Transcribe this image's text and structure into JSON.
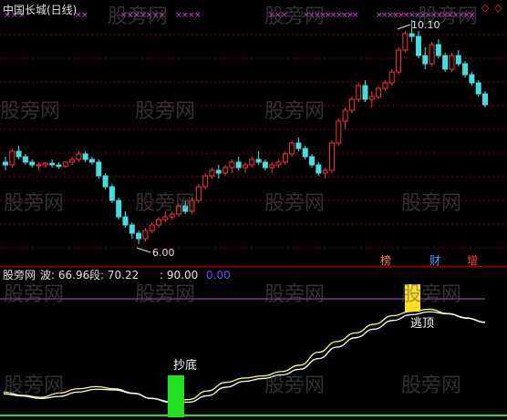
{
  "main_panel": {
    "title": "中国长城(日线)",
    "price_high_label": "10.10",
    "price_low_label": "6.00",
    "badges": [
      {
        "text": "榜",
        "color": "#ff8040"
      },
      {
        "text": "财",
        "color": "#40a0ff"
      },
      {
        "text": "增",
        "color": "#ff4040"
      }
    ],
    "diamond_color": "#ff3030"
  },
  "indicator_panel": {
    "name": "股旁网",
    "wave_label": "波: 66.96",
    "segment_label": "段: 70.22",
    "level_label": ": 90.00",
    "zero_label": "0.00",
    "bottom_signal": "抄底",
    "top_signal": "逃顶"
  },
  "watermark": "股旁网",
  "colors": {
    "up": "#ff3030",
    "down": "#40e0e0",
    "grid": "#8b0000",
    "ma_line": "#ffff60",
    "signal_white": "#ffffff",
    "level_line": "#c040c0",
    "bottom_bar": "#20e020",
    "top_bar": "#ffe020",
    "marker": "#e040e0"
  },
  "chart_data": {
    "type": "candlestick",
    "title": "中国长城(日线)",
    "annotations": [
      "10.10",
      "6.00"
    ],
    "approx_price_range": [
      6.0,
      10.1
    ],
    "candles": [
      [
        7.5,
        7.6,
        7.35,
        7.45
      ],
      [
        7.45,
        7.75,
        7.4,
        7.7
      ],
      [
        7.7,
        7.8,
        7.55,
        7.6
      ],
      [
        7.6,
        7.65,
        7.45,
        7.5
      ],
      [
        7.5,
        7.55,
        7.4,
        7.45
      ],
      [
        7.45,
        7.5,
        7.35,
        7.45
      ],
      [
        7.45,
        7.5,
        7.4,
        7.48
      ],
      [
        7.48,
        7.55,
        7.4,
        7.45
      ],
      [
        7.45,
        7.5,
        7.38,
        7.42
      ],
      [
        7.42,
        7.52,
        7.4,
        7.5
      ],
      [
        7.5,
        7.6,
        7.45,
        7.55
      ],
      [
        7.55,
        7.7,
        7.5,
        7.65
      ],
      [
        7.65,
        7.7,
        7.5,
        7.55
      ],
      [
        7.55,
        7.6,
        7.45,
        7.5
      ],
      [
        7.5,
        7.55,
        7.2,
        7.25
      ],
      [
        7.25,
        7.3,
        7.0,
        7.05
      ],
      [
        7.05,
        7.1,
        6.75,
        6.8
      ],
      [
        6.8,
        6.85,
        6.45,
        6.5
      ],
      [
        6.5,
        6.6,
        6.3,
        6.35
      ],
      [
        6.35,
        6.4,
        6.1,
        6.2
      ],
      [
        6.2,
        6.25,
        6.0,
        6.1
      ],
      [
        6.1,
        6.3,
        6.05,
        6.25
      ],
      [
        6.25,
        6.4,
        6.2,
        6.35
      ],
      [
        6.35,
        6.5,
        6.3,
        6.45
      ],
      [
        6.45,
        6.6,
        6.4,
        6.5
      ],
      [
        6.5,
        6.6,
        6.45,
        6.55
      ],
      [
        6.55,
        6.75,
        6.5,
        6.7
      ],
      [
        6.7,
        6.8,
        6.55,
        6.6
      ],
      [
        6.6,
        6.85,
        6.55,
        6.8
      ],
      [
        6.8,
        7.1,
        6.75,
        7.05
      ],
      [
        7.05,
        7.3,
        7.0,
        7.25
      ],
      [
        7.25,
        7.4,
        7.2,
        7.35
      ],
      [
        7.35,
        7.45,
        7.2,
        7.3
      ],
      [
        7.3,
        7.45,
        7.25,
        7.4
      ],
      [
        7.4,
        7.55,
        7.3,
        7.5
      ],
      [
        7.5,
        7.6,
        7.35,
        7.4
      ],
      [
        7.4,
        7.5,
        7.3,
        7.45
      ],
      [
        7.45,
        7.6,
        7.4,
        7.55
      ],
      [
        7.55,
        7.7,
        7.45,
        7.5
      ],
      [
        7.5,
        7.55,
        7.35,
        7.4
      ],
      [
        7.4,
        7.5,
        7.3,
        7.45
      ],
      [
        7.45,
        7.55,
        7.4,
        7.5
      ],
      [
        7.5,
        7.7,
        7.45,
        7.65
      ],
      [
        7.65,
        7.9,
        7.6,
        7.85
      ],
      [
        7.85,
        7.95,
        7.7,
        7.75
      ],
      [
        7.75,
        7.8,
        7.55,
        7.6
      ],
      [
        7.6,
        7.65,
        7.4,
        7.45
      ],
      [
        7.45,
        7.5,
        7.25,
        7.3
      ],
      [
        7.3,
        7.4,
        7.2,
        7.35
      ],
      [
        7.35,
        7.9,
        7.3,
        7.85
      ],
      [
        7.85,
        8.3,
        7.8,
        8.25
      ],
      [
        8.25,
        8.5,
        8.1,
        8.45
      ],
      [
        8.45,
        8.7,
        8.4,
        8.65
      ],
      [
        8.65,
        8.95,
        8.6,
        8.9
      ],
      [
        8.9,
        9.0,
        8.6,
        8.65
      ],
      [
        8.65,
        8.8,
        8.5,
        8.7
      ],
      [
        8.7,
        8.9,
        8.65,
        8.85
      ],
      [
        8.85,
        9.0,
        8.8,
        8.95
      ],
      [
        8.95,
        9.2,
        8.9,
        9.15
      ],
      [
        9.15,
        9.6,
        9.1,
        9.55
      ],
      [
        9.55,
        9.9,
        9.5,
        9.85
      ],
      [
        9.85,
        10.1,
        9.7,
        9.8
      ],
      [
        9.8,
        9.9,
        9.4,
        9.45
      ],
      [
        9.45,
        9.6,
        9.2,
        9.3
      ],
      [
        9.3,
        9.7,
        9.25,
        9.65
      ],
      [
        9.65,
        9.75,
        9.4,
        9.45
      ],
      [
        9.45,
        9.5,
        9.15,
        9.2
      ],
      [
        9.2,
        9.5,
        9.15,
        9.45
      ],
      [
        9.45,
        9.55,
        9.25,
        9.3
      ],
      [
        9.3,
        9.35,
        9.05,
        9.1
      ],
      [
        9.1,
        9.15,
        8.9,
        8.95
      ],
      [
        8.95,
        9.0,
        8.7,
        8.75
      ],
      [
        8.75,
        8.8,
        8.5,
        8.55
      ]
    ],
    "signal_curves": {
      "name": "股旁网",
      "points_approx": [
        15,
        12,
        10,
        14,
        18,
        20,
        18,
        14,
        9,
        6,
        8,
        16,
        24,
        28,
        30,
        34,
        40,
        52,
        62,
        70,
        78,
        86,
        90,
        92,
        88,
        84,
        80
      ]
    }
  }
}
